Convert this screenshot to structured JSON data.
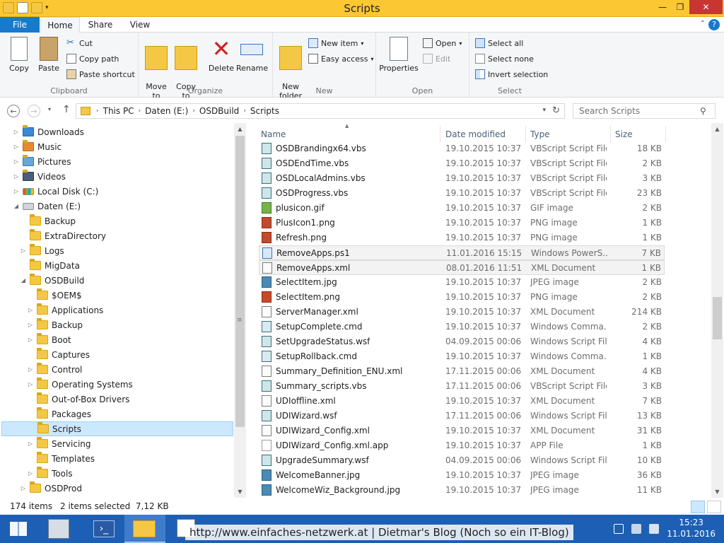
{
  "window": {
    "title": "Scripts"
  },
  "ribbon_tabs": {
    "file": "File",
    "home": "Home",
    "share": "Share",
    "view": "View"
  },
  "ribbon": {
    "clipboard": {
      "label": "Clipboard",
      "copy": "Copy",
      "paste": "Paste",
      "cut": "Cut",
      "copy_path": "Copy path",
      "paste_shortcut": "Paste shortcut"
    },
    "organize": {
      "label": "Organize",
      "move_to": "Move\nto",
      "copy_to": "Copy\nto",
      "delete": "Delete",
      "rename": "Rename"
    },
    "new": {
      "label": "New",
      "new_folder": "New\nfolder",
      "new_item": "New item",
      "easy_access": "Easy access"
    },
    "open": {
      "label": "Open",
      "properties": "Properties",
      "open": "Open",
      "edit": "Edit"
    },
    "select": {
      "label": "Select",
      "select_all": "Select all",
      "select_none": "Select none",
      "invert": "Invert selection"
    }
  },
  "address": {
    "crumbs": [
      "This PC",
      "Daten (E:)",
      "OSDBuild",
      "Scripts"
    ],
    "search_placeholder": "Search Scripts"
  },
  "nav_tree": [
    {
      "label": "Downloads",
      "level": 0,
      "twisty": "▷",
      "icon": "lib-dl"
    },
    {
      "label": "Music",
      "level": 0,
      "twisty": "▷",
      "icon": "lib-mu"
    },
    {
      "label": "Pictures",
      "level": 0,
      "twisty": "▷",
      "icon": "lib-pi"
    },
    {
      "label": "Videos",
      "level": 0,
      "twisty": "▷",
      "icon": "lib-vi"
    },
    {
      "label": "Local Disk (C:)",
      "level": 0,
      "twisty": "▷",
      "icon": "drive-win"
    },
    {
      "label": "Daten (E:)",
      "level": 0,
      "twisty": "◢",
      "icon": "drive"
    },
    {
      "label": "Backup",
      "level": 1,
      "twisty": "",
      "icon": "folder"
    },
    {
      "label": "ExtraDirectory",
      "level": 1,
      "twisty": "",
      "icon": "folder"
    },
    {
      "label": "Logs",
      "level": 1,
      "twisty": "▷",
      "icon": "folder"
    },
    {
      "label": "MigData",
      "level": 1,
      "twisty": "",
      "icon": "folder"
    },
    {
      "label": "OSDBuild",
      "level": 1,
      "twisty": "◢",
      "icon": "folder"
    },
    {
      "label": "$OEM$",
      "level": 2,
      "twisty": "",
      "icon": "folder"
    },
    {
      "label": "Applications",
      "level": 2,
      "twisty": "▷",
      "icon": "folder"
    },
    {
      "label": "Backup",
      "level": 2,
      "twisty": "▷",
      "icon": "folder"
    },
    {
      "label": "Boot",
      "level": 2,
      "twisty": "▷",
      "icon": "folder"
    },
    {
      "label": "Captures",
      "level": 2,
      "twisty": "",
      "icon": "folder"
    },
    {
      "label": "Control",
      "level": 2,
      "twisty": "▷",
      "icon": "folder"
    },
    {
      "label": "Operating Systems",
      "level": 2,
      "twisty": "▷",
      "icon": "folder"
    },
    {
      "label": "Out-of-Box Drivers",
      "level": 2,
      "twisty": "",
      "icon": "folder"
    },
    {
      "label": "Packages",
      "level": 2,
      "twisty": "",
      "icon": "folder"
    },
    {
      "label": "Scripts",
      "level": 2,
      "twisty": "",
      "icon": "folder",
      "selected": true
    },
    {
      "label": "Servicing",
      "level": 2,
      "twisty": "▷",
      "icon": "folder"
    },
    {
      "label": "Templates",
      "level": 2,
      "twisty": "",
      "icon": "folder"
    },
    {
      "label": "Tools",
      "level": 2,
      "twisty": "▷",
      "icon": "folder"
    },
    {
      "label": "OSDProd",
      "level": 1,
      "twisty": "▷",
      "icon": "folder"
    }
  ],
  "columns": {
    "name": "Name",
    "date": "Date modified",
    "type": "Type",
    "size": "Size"
  },
  "files": [
    {
      "name": "OSDBrandingx64.vbs",
      "date": "19.10.2015 10:37",
      "type": "VBScript Script File",
      "size": "18 KB",
      "icon": "ft-vbs"
    },
    {
      "name": "OSDEndTime.vbs",
      "date": "19.10.2015 10:37",
      "type": "VBScript Script File",
      "size": "2 KB",
      "icon": "ft-vbs"
    },
    {
      "name": "OSDLocalAdmins.vbs",
      "date": "19.10.2015 10:37",
      "type": "VBScript Script File",
      "size": "3 KB",
      "icon": "ft-vbs"
    },
    {
      "name": "OSDProgress.vbs",
      "date": "19.10.2015 10:37",
      "type": "VBScript Script File",
      "size": "23 KB",
      "icon": "ft-vbs"
    },
    {
      "name": "plusicon.gif",
      "date": "19.10.2015 10:37",
      "type": "GIF image",
      "size": "2 KB",
      "icon": "ft-gif"
    },
    {
      "name": "PlusIcon1.png",
      "date": "19.10.2015 10:37",
      "type": "PNG image",
      "size": "1 KB",
      "icon": "ft-img"
    },
    {
      "name": "Refresh.png",
      "date": "19.10.2015 10:37",
      "type": "PNG image",
      "size": "1 KB",
      "icon": "ft-img"
    },
    {
      "name": "RemoveApps.ps1",
      "date": "11.01.2016 15:15",
      "type": "Windows PowerS...",
      "size": "7 KB",
      "icon": "ft-ps",
      "selected": true
    },
    {
      "name": "RemoveApps.xml",
      "date": "08.01.2016 11:51",
      "type": "XML Document",
      "size": "1 KB",
      "icon": "ft-xml",
      "selected": true
    },
    {
      "name": "SelectItem.jpg",
      "date": "19.10.2015 10:37",
      "type": "JPEG image",
      "size": "2 KB",
      "icon": "ft-jpg"
    },
    {
      "name": "SelectItem.png",
      "date": "19.10.2015 10:37",
      "type": "PNG image",
      "size": "2 KB",
      "icon": "ft-img"
    },
    {
      "name": "ServerManager.xml",
      "date": "19.10.2015 10:37",
      "type": "XML Document",
      "size": "214 KB",
      "icon": "ft-xml"
    },
    {
      "name": "SetupComplete.cmd",
      "date": "19.10.2015 10:37",
      "type": "Windows Comma...",
      "size": "2 KB",
      "icon": "ft-cmd"
    },
    {
      "name": "SetUpgradeStatus.wsf",
      "date": "04.09.2015 00:06",
      "type": "Windows Script File",
      "size": "4 KB",
      "icon": "ft-vbs"
    },
    {
      "name": "SetupRollback.cmd",
      "date": "19.10.2015 10:37",
      "type": "Windows Comma...",
      "size": "1 KB",
      "icon": "ft-cmd"
    },
    {
      "name": "Summary_Definition_ENU.xml",
      "date": "17.11.2015 00:06",
      "type": "XML Document",
      "size": "4 KB",
      "icon": "ft-xml"
    },
    {
      "name": "Summary_scripts.vbs",
      "date": "17.11.2015 00:06",
      "type": "VBScript Script File",
      "size": "3 KB",
      "icon": "ft-vbs"
    },
    {
      "name": "UDIoffline.xml",
      "date": "19.10.2015 10:37",
      "type": "XML Document",
      "size": "7 KB",
      "icon": "ft-xml"
    },
    {
      "name": "UDIWizard.wsf",
      "date": "17.11.2015 00:06",
      "type": "Windows Script File",
      "size": "13 KB",
      "icon": "ft-vbs"
    },
    {
      "name": "UDIWizard_Config.xml",
      "date": "19.10.2015 10:37",
      "type": "XML Document",
      "size": "31 KB",
      "icon": "ft-xml"
    },
    {
      "name": "UDIWizard_Config.xml.app",
      "date": "19.10.2015 10:37",
      "type": "APP File",
      "size": "1 KB",
      "icon": "ft-app"
    },
    {
      "name": "UpgradeSummary.wsf",
      "date": "04.09.2015 00:06",
      "type": "Windows Script File",
      "size": "10 KB",
      "icon": "ft-vbs"
    },
    {
      "name": "WelcomeBanner.jpg",
      "date": "19.10.2015 10:37",
      "type": "JPEG image",
      "size": "36 KB",
      "icon": "ft-jpg"
    },
    {
      "name": "WelcomeWiz_Background.jpg",
      "date": "19.10.2015 10:37",
      "type": "JPEG image",
      "size": "11 KB",
      "icon": "ft-jpg"
    }
  ],
  "status": {
    "items": "174 items",
    "selected": "2 items selected  7,12 KB"
  },
  "taskbar": {
    "watermark": "http://www.einfaches-netzwerk.at | Dietmar's Blog (Noch so ein IT-Blog)",
    "time": "15:23",
    "date": "11.01.2016"
  },
  "colors": {
    "titlebar": "#fbc833",
    "accent": "#1979ca",
    "taskbar": "#1d5fb4",
    "selection": "#cce8ff"
  }
}
